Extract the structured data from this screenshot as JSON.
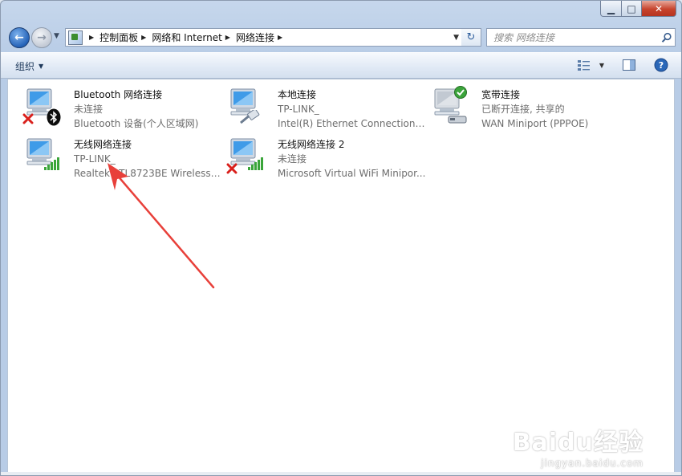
{
  "window": {
    "minimize_glyph": "▁",
    "maximize_glyph": "□",
    "close_glyph": "✕"
  },
  "nav": {
    "back_glyph": "←",
    "forward_glyph": "→",
    "breadcrumbs": [
      "控制面板",
      "网络和 Internet",
      "网络连接"
    ],
    "refresh_glyph": "↻",
    "search_placeholder": "搜索 网络连接"
  },
  "toolbar": {
    "organize_label": "组织"
  },
  "connections": [
    {
      "name": "Bluetooth 网络连接",
      "status": "未连接",
      "device": "Bluetooth 设备(个人区域网)",
      "badge": "disconnected-x",
      "icon": "bluetooth-icon"
    },
    {
      "name": "本地连接",
      "status": "TP-LINK_",
      "device": "Intel(R) Ethernet Connection I2...",
      "badge": "none",
      "icon": "ethernet-cable-icon"
    },
    {
      "name": "宽带连接",
      "status": "已断开连接, 共享的",
      "device": "WAN Miniport (PPPOE)",
      "badge": "check-green",
      "icon": "modem-icon"
    },
    {
      "name": "无线网络连接",
      "status": "TP-LINK_",
      "device": "Realtek RTL8723BE Wireless L...",
      "badge": "none",
      "icon": "wifi-signal-icon"
    },
    {
      "name": "无线网络连接 2",
      "status": "未连接",
      "device": "Microsoft Virtual WiFi Minipor...",
      "badge": "disconnected-x",
      "icon": "wifi-signal-icon"
    }
  ],
  "watermark": {
    "logo": "Baidu经验",
    "url": "jingyan.baidu.com"
  },
  "colors": {
    "accent_red_arrow": "#e8403a",
    "status_gray": "#6d6d6d",
    "signal_green": "#3aa53a"
  }
}
